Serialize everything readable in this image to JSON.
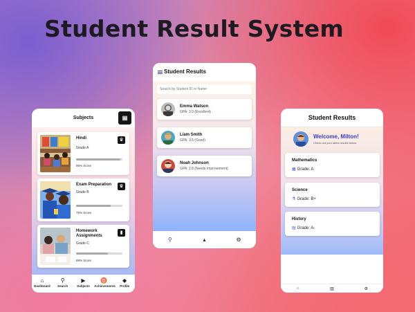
{
  "title": "Student Result System",
  "phone1": {
    "header": "Subjects",
    "header_icon": "book-icon",
    "subjects": [
      {
        "name": "Hindi",
        "grade": "Grade A",
        "score": "95% Score",
        "progress": 0.95,
        "icon": "trophy-icon"
      },
      {
        "name": "Exam Preparation",
        "grade": "Grade B",
        "score": "75% Score",
        "progress": 0.75,
        "icon": "trophy-icon"
      },
      {
        "name": "Homework Assignments",
        "grade": "Grade C",
        "score": "68% Score",
        "progress": 0.68,
        "icon": "clipboard-icon"
      }
    ],
    "nav": [
      {
        "label": "Dashboard",
        "icon": "home-icon"
      },
      {
        "label": "Search",
        "icon": "search-icon"
      },
      {
        "label": "Subjects",
        "icon": "play-circle-icon"
      },
      {
        "label": "Achievements",
        "icon": "medal-icon"
      },
      {
        "label": "Profile",
        "icon": "graduation-cap-icon"
      }
    ]
  },
  "phone2": {
    "header": "Student Results",
    "search_placeholder": "Search by Student ID or Name",
    "students": [
      {
        "name": "Emma Watson",
        "gpa": "GPA: 3.9 (Excellent)"
      },
      {
        "name": "Liam Smith",
        "gpa": "GPA: 3.5 (Good)"
      },
      {
        "name": "Noah Johnson",
        "gpa": "GPA: 2.8 (Needs Improvement)"
      }
    ],
    "nav": [
      "search-icon",
      "chart-icon",
      "gear-icon"
    ]
  },
  "phone3": {
    "header": "Student Results",
    "welcome": "Welcome, Milton!",
    "subtitle": "Check out your latest results below.",
    "results": [
      {
        "subject": "Mathematics",
        "grade": "Grade: A",
        "icon": "calculator-icon"
      },
      {
        "subject": "Science",
        "grade": "Grade: B+",
        "icon": "flask-icon"
      },
      {
        "subject": "History",
        "grade": "Grade: A-",
        "icon": "book-icon"
      }
    ],
    "nav": [
      "home-icon",
      "chart-icon",
      "gear-icon"
    ]
  },
  "colors": {
    "accent": "#3f46c9",
    "dark": "#151515"
  }
}
